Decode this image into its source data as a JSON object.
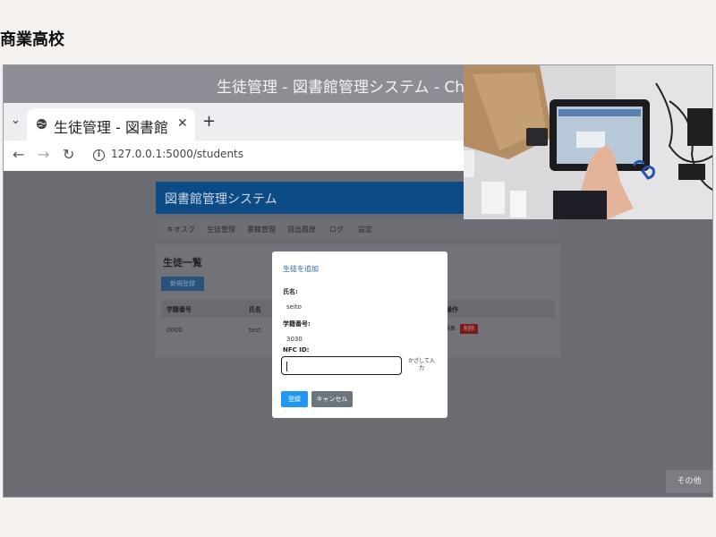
{
  "slide": {
    "title": "商業高校"
  },
  "browser": {
    "window_title": "生徒管理 - 図書館管理システム - Chro",
    "tab_title": "生徒管理 - 図書館",
    "url": "127.0.0.1:5000/students"
  },
  "app": {
    "header": "図書館管理システム",
    "nav": [
      "キオスク",
      "生徒管理",
      "書籍管理",
      "貸出履歴",
      "ログ",
      "設定"
    ],
    "page_title": "生徒一覧",
    "register_button": "新規登録",
    "table": {
      "columns": [
        "学籍番号",
        "氏名",
        "操作"
      ],
      "rows": [
        {
          "id": "0000",
          "name": "test",
          "edit": "編集",
          "delete": "削除"
        }
      ]
    }
  },
  "modal": {
    "title": "生徒を追加",
    "name_label": "氏名:",
    "name_value": "seito",
    "student_id_label": "学籍番号:",
    "student_id_value": "3030",
    "nfc_label": "NFC ID:",
    "nfc_value": "",
    "tap_button": "かざして入力",
    "submit_button": "登録",
    "cancel_button": "キャンセル"
  },
  "other_button": "その他",
  "colors": {
    "app_header": "#0c4b86",
    "primary": "#2196f3",
    "danger": "#c62828",
    "cancel": "#6c757d"
  }
}
